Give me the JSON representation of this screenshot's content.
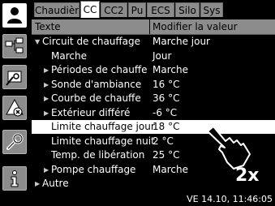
{
  "tabs": [
    "Chaudière",
    "CC",
    "CC2",
    "Pu",
    "ECS",
    "Silo",
    "Sys"
  ],
  "active_tab": 1,
  "header": {
    "col1": "Texte",
    "col2": "Modifier la valeur"
  },
  "rows": [
    {
      "text": "Circuit de chauffage",
      "value": "Marche jour",
      "marker": "▼"
    },
    {
      "text": "Marche",
      "value": "Jour",
      "marker": ""
    },
    {
      "text": "Périodes de chauffe",
      "value": "Marche",
      "marker": "▶"
    },
    {
      "text": "Sonde d'ambiance",
      "value": "16 °C",
      "marker": "▶"
    },
    {
      "text": "Courbe de chauffe",
      "value": "36 °C",
      "marker": "▶"
    },
    {
      "text": "Extérieur différé",
      "value": "-6 °C",
      "marker": "▶"
    },
    {
      "text": "Limite chauffage jour",
      "value": "18 °C",
      "marker": "",
      "selected": true
    },
    {
      "text": "Limite chauffage nuit",
      "value": "2 °C",
      "marker": ""
    },
    {
      "text": "Temp. de libération",
      "value": "25 °C",
      "marker": ""
    },
    {
      "text": "Pompe chauffage",
      "value": "Marche",
      "marker": "▶"
    },
    {
      "text": "Autre",
      "value": "",
      "marker": "▶"
    }
  ],
  "status": "VE 14.10, 11:46:05",
  "gesture_label": "2x",
  "sidebar": [
    "user-icon",
    "network-icon",
    "tools-screen-icon",
    "warning-icon",
    "wrench-icon",
    "info-icon"
  ],
  "colors": {
    "background": "#000000",
    "tab_inactive": "#8c8c8c",
    "selection": "#ffffff",
    "text": "#ffffff"
  }
}
